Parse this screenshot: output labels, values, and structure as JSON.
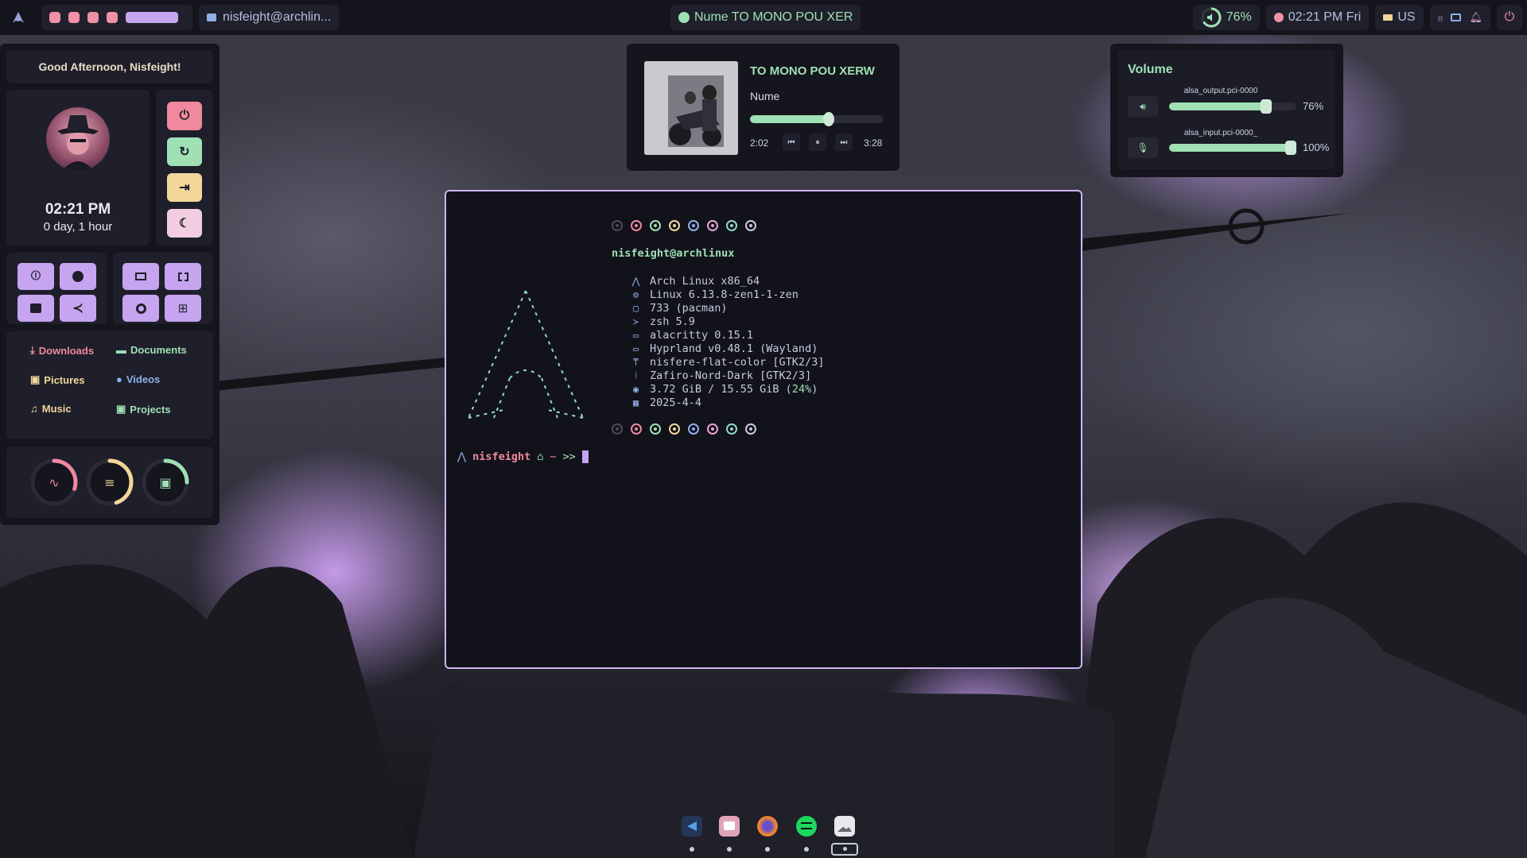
{
  "topbar": {
    "window_title": "nisfeight@archlin...",
    "now_playing": "Nume TO MONO POU XER",
    "volume": "76%",
    "clock": "02:21 PM Fri",
    "keyboard_layout": "US"
  },
  "dashboard": {
    "greeting": "Good Afternoon, Nisfeight!",
    "time": "02:21 PM",
    "uptime": "0 day, 1 hour",
    "folders": [
      {
        "label": "Downloads",
        "color": "#f0889e",
        "icon": "download-icon"
      },
      {
        "label": "Documents",
        "color": "#9fe0b4",
        "icon": "folder-icon"
      },
      {
        "label": "Pictures",
        "color": "#f2d69a",
        "icon": "image-icon"
      },
      {
        "label": "Videos",
        "color": "#8fb0e8",
        "icon": "video-icon"
      },
      {
        "label": "Music",
        "color": "#f2d69a",
        "icon": "music-icon"
      },
      {
        "label": "Projects",
        "color": "#9fe0b4",
        "icon": "code-icon"
      }
    ],
    "power_buttons": [
      "power-icon",
      "restart-icon",
      "logout-icon",
      "sleep-icon"
    ],
    "gauges": [
      {
        "name": "cpu",
        "value": 0.3,
        "color": "#f0889e",
        "icon": "pulse-icon"
      },
      {
        "name": "memory",
        "value": 0.45,
        "color": "#f2d69a",
        "icon": "memory-icon"
      },
      {
        "name": "disk",
        "value": 0.25,
        "color": "#9fe0b4",
        "icon": "disk-icon"
      }
    ]
  },
  "music": {
    "title": "TO MONO POU XERW",
    "artist": "Nume",
    "elapsed": "2:02",
    "duration": "3:28",
    "progress": 0.59
  },
  "volume_panel": {
    "title": "Volume",
    "output": {
      "device": "alsa_output.pci-0000",
      "percent": "76%",
      "level": 0.76
    },
    "input": {
      "device": "alsa_input.pci-0000_",
      "percent": "100%",
      "level": 1.0
    }
  },
  "terminal": {
    "user_host": "nisfeight@archlinux",
    "info": [
      {
        "icon": "arch-icon",
        "text": "Arch Linux x86_64"
      },
      {
        "icon": "gear-icon",
        "text": "Linux 6.13.8-zen1-1-zen"
      },
      {
        "icon": "package-icon",
        "text": "733 (pacman)"
      },
      {
        "icon": "shell-icon",
        "text": "zsh 5.9"
      },
      {
        "icon": "terminal-icon",
        "text": "alacritty 0.15.1"
      },
      {
        "icon": "window-icon",
        "text": "Hyprland v0.48.1 (Wayland)"
      },
      {
        "icon": "brush-icon",
        "text": "nisfere-flat-color [GTK2/3]"
      },
      {
        "icon": "grid-icon",
        "text": "Zafiro-Nord-Dark [GTK2/3]"
      },
      {
        "icon": "memory-icon",
        "text": "3.72 GiB / 15.55 GiB (",
        "highlight": "24%",
        "suffix": ")"
      },
      {
        "icon": "calendar-icon",
        "text": "2025-4-4"
      }
    ],
    "prompt_user": "nisfeight",
    "prompt_path": "~",
    "prompt_symbol": ">>",
    "palette": [
      "#4a4b5a",
      "#f0889e",
      "#9fe0b4",
      "#f2d69a",
      "#8fb0e8",
      "#e8a6d4",
      "#8fdcc8",
      "#c8cbe0"
    ]
  },
  "dock": {
    "apps": [
      "vscode-icon",
      "files-icon",
      "firefox-icon",
      "spotify-icon",
      "image-viewer-icon"
    ],
    "active_index": 4
  }
}
